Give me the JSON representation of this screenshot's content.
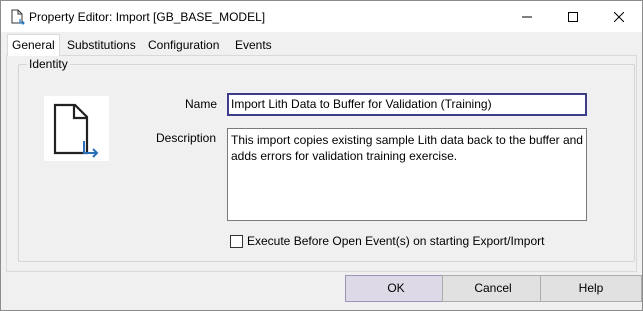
{
  "window": {
    "title": "Property Editor: Import [GB_BASE_MODEL]"
  },
  "tabs": [
    {
      "label": "General",
      "active": true
    },
    {
      "label": "Substitutions",
      "active": false
    },
    {
      "label": "Configuration",
      "active": false
    },
    {
      "label": "Events",
      "active": false
    }
  ],
  "identity": {
    "group_label": "Identity",
    "name_label": "Name",
    "name_value": "Import Lith Data to Buffer for Validation (Training)",
    "description_label": "Description",
    "description_value": "This import copies existing sample Lith data back to the buffer and adds errors for validation training exercise.",
    "checkbox_label": "Execute Before Open Event(s) on starting Export/Import",
    "checkbox_checked": false,
    "icon": "document-import-icon"
  },
  "buttons": {
    "ok": "OK",
    "cancel": "Cancel",
    "help": "Help"
  },
  "colors": {
    "accent": "#0078d7",
    "name_border": "#3d3d8a",
    "window_bg": "#f0f0f0"
  }
}
